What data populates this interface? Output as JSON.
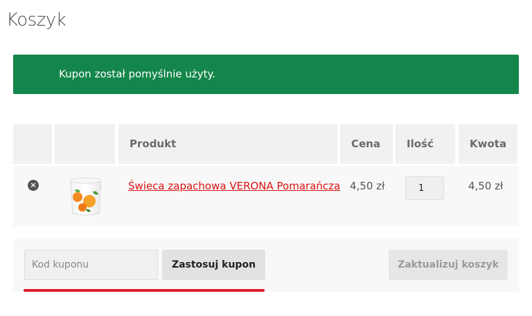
{
  "page": {
    "title": "Koszyk"
  },
  "notice": {
    "message": "Kupon został pomyślnie użyty."
  },
  "cart": {
    "headers": {
      "product": "Produkt",
      "price": "Cena",
      "quantity": "Ilość",
      "total": "Kwota"
    },
    "items": [
      {
        "name": "Świeca zapachowa VERONA Pomarańcza",
        "price": "4,50 zł",
        "quantity": "1",
        "total": "4,50 zł",
        "remove_icon": "×"
      }
    ]
  },
  "coupon": {
    "placeholder": "Kod kuponu",
    "apply_label": "Zastosuj kupon"
  },
  "update": {
    "label": "Zaktualizuj koszyk"
  },
  "colors": {
    "notice_bg": "#14864b",
    "link": "#dd1111",
    "underline": "#e01b2a"
  }
}
